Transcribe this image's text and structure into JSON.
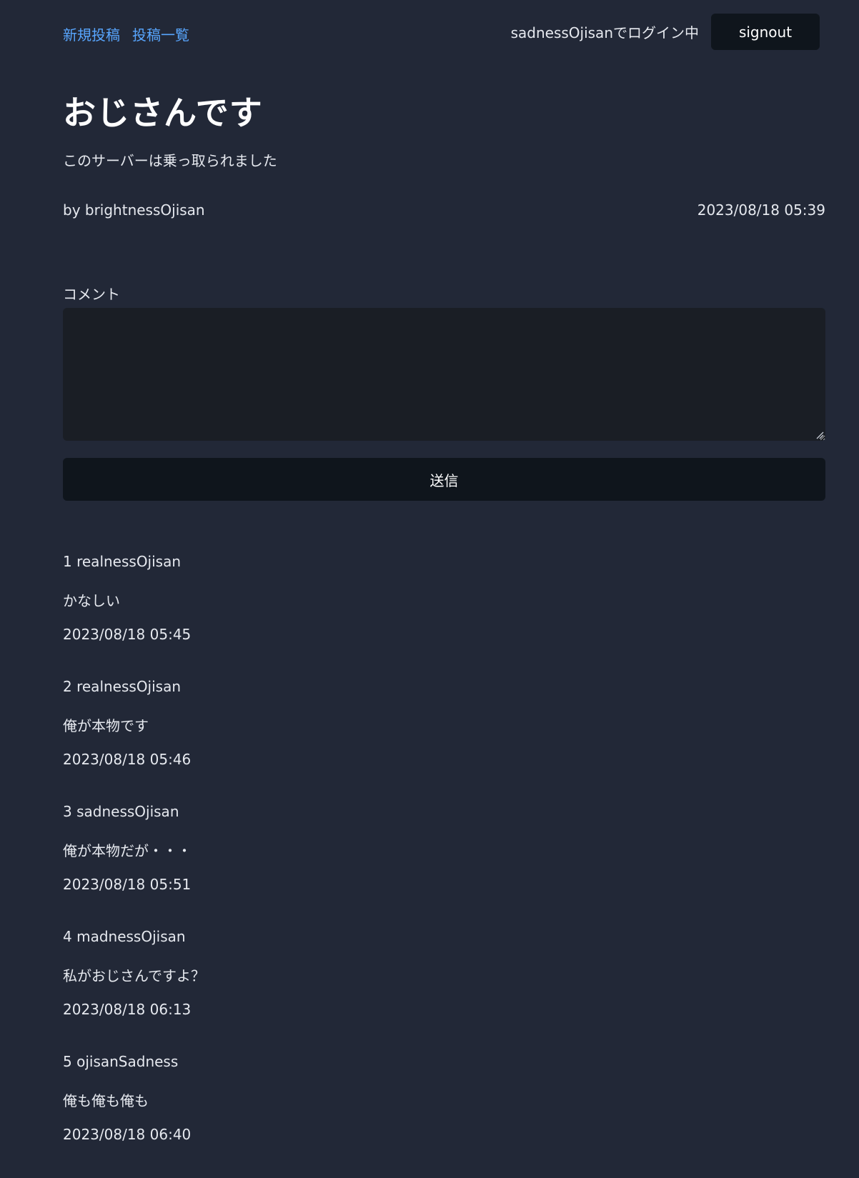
{
  "nav": {
    "new_post": "新規投稿",
    "post_list": "投稿一覧"
  },
  "user": {
    "login_status": "sadnessOjisanでログイン中",
    "signout_label": "signout"
  },
  "post": {
    "title": "おじさんです",
    "body": "このサーバーは乗っ取られました",
    "author": "by brightnessOjisan",
    "timestamp": "2023/08/18 05:39"
  },
  "comment_form": {
    "label": "コメント",
    "value": "",
    "submit_label": "送信"
  },
  "comments": [
    {
      "number": "1",
      "user": "realnessOjisan",
      "text": "かなしい",
      "timestamp": "2023/08/18 05:45"
    },
    {
      "number": "2",
      "user": "realnessOjisan",
      "text": "俺が本物です",
      "timestamp": "2023/08/18 05:46"
    },
    {
      "number": "3",
      "user": "sadnessOjisan",
      "text": "俺が本物だが・・・",
      "timestamp": "2023/08/18 05:51"
    },
    {
      "number": "4",
      "user": "madnessOjisan",
      "text": "私がおじさんですよ？",
      "timestamp": "2023/08/18 06:13"
    },
    {
      "number": "5",
      "user": "ojisanSadness",
      "text": "俺も俺も俺も",
      "timestamp": "2023/08/18 06:40"
    }
  ],
  "colors": {
    "background": "#222837",
    "link": "#58a6ff",
    "button_bg": "#0f151c",
    "textarea_bg": "#1a1e25"
  }
}
